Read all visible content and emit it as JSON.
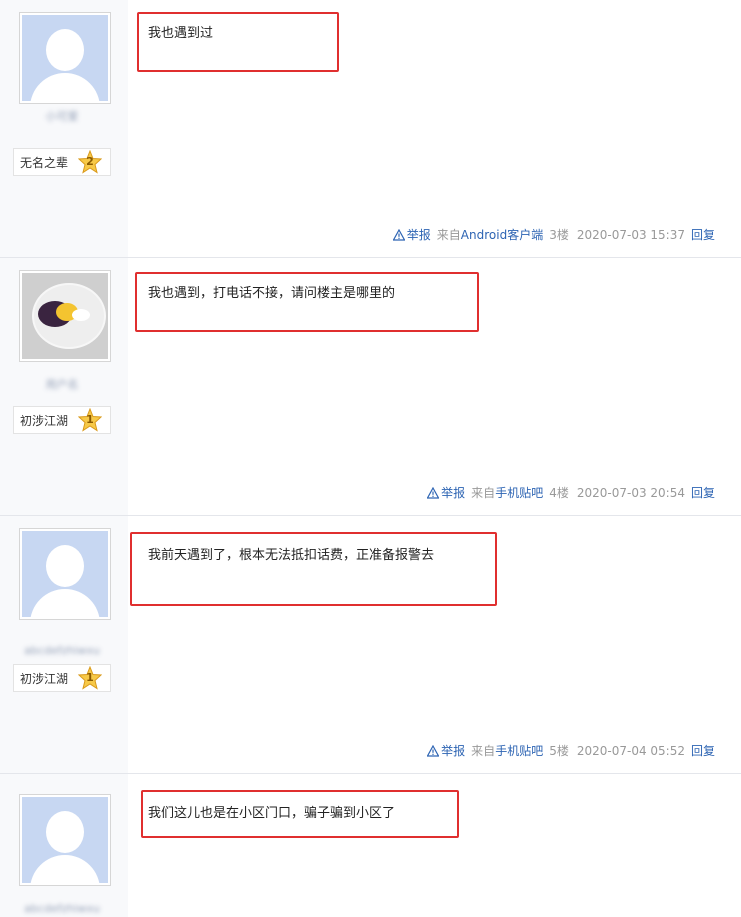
{
  "posts": [
    {
      "avatar": "default-avatar",
      "username": "小可爱",
      "level_name": "无名之辈",
      "level_num": "2",
      "content": "我也遇到过",
      "report": "举报",
      "source_prefix": "来自",
      "source": "Android客户端",
      "floor": "3楼",
      "time": "2020-07-03 15:37",
      "reply": "回复"
    },
    {
      "avatar": "photo-avatar",
      "username": "用户名",
      "level_name": "初涉江湖",
      "level_num": "1",
      "content": "我也遇到，打电话不接，请问楼主是哪里的",
      "report": "举报",
      "source_prefix": "来自",
      "source": "手机贴吧",
      "floor": "4楼",
      "time": "2020-07-03 20:54",
      "reply": "回复"
    },
    {
      "avatar": "default-avatar",
      "username": "abcdefzhiwxu",
      "level_name": "初涉江湖",
      "level_num": "1",
      "content": "我前天遇到了，根本无法抵扣话费，正准备报警去",
      "report": "举报",
      "source_prefix": "来自",
      "source": "手机贴吧",
      "floor": "5楼",
      "time": "2020-07-04 05:52",
      "reply": "回复"
    },
    {
      "avatar": "default-avatar",
      "username": "abcdefzhiwxu",
      "content": "我们这儿也是在小区门口，骗子骗到小区了"
    }
  ],
  "colors": {
    "highlight_box": "#e02f2f",
    "link": "#2d64b3",
    "sidebar_bg": "#f8f9fb"
  }
}
